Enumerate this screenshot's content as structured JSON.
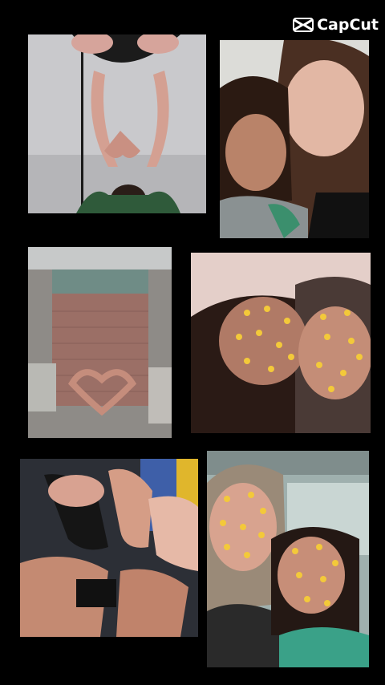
{
  "watermark": {
    "label": "CapCut",
    "icon": "capcut-logo-icon"
  },
  "photos": [
    {
      "id": "photo-1",
      "subject": "handstand-heart-hands"
    },
    {
      "id": "photo-2",
      "subject": "two-girls-selfie"
    },
    {
      "id": "photo-3",
      "subject": "heart-hands-on-pavement"
    },
    {
      "id": "photo-4",
      "subject": "selfie-with-pizza-filter"
    },
    {
      "id": "photo-5",
      "subject": "feet-in-sandals-on-bus"
    },
    {
      "id": "photo-6",
      "subject": "bus-selfie-with-pizza-filter"
    }
  ],
  "colors": {
    "background": "#000000",
    "watermark": "#ffffff"
  }
}
